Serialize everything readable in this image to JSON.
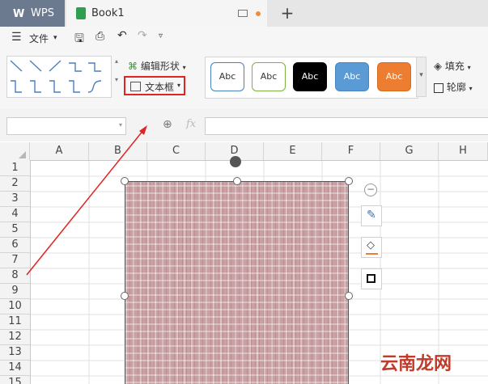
{
  "titlebar": {
    "app_tab": "WPS",
    "doc_tab": "Book1"
  },
  "menu": {
    "file_label": "文件"
  },
  "ribbon": {
    "edit_shape_label": "编辑形状",
    "textbox_label": "文本框",
    "styles": [
      {
        "label": "Abc",
        "bg": "#ffffff",
        "border": "#4a7fc1",
        "fg": "#333333"
      },
      {
        "label": "Abc",
        "bg": "#ffffff",
        "border": "#7cb342",
        "fg": "#333333"
      },
      {
        "label": "Abc",
        "bg": "#000000",
        "border": "#000000",
        "fg": "#ffffff"
      },
      {
        "label": "Abc",
        "bg": "#5b9bd5",
        "border": "#4a85bd",
        "fg": "#ffffff"
      },
      {
        "label": "Abc",
        "bg": "#ed7d31",
        "border": "#d66b22",
        "fg": "#ffffff"
      }
    ],
    "fill_label": "填充",
    "outline_label": "轮廓"
  },
  "formula": {
    "fx_label": "fx"
  },
  "sheet": {
    "columns": [
      "A",
      "B",
      "C",
      "D",
      "E",
      "F",
      "G",
      "H"
    ],
    "rows": [
      "1",
      "2",
      "3",
      "4",
      "5",
      "6",
      "7",
      "8",
      "9",
      "10",
      "11",
      "12",
      "13",
      "14",
      "15"
    ]
  },
  "watermark": "云南龙网",
  "colors": {
    "highlight": "#e02424",
    "shape_fill": "#c9a0a3"
  }
}
